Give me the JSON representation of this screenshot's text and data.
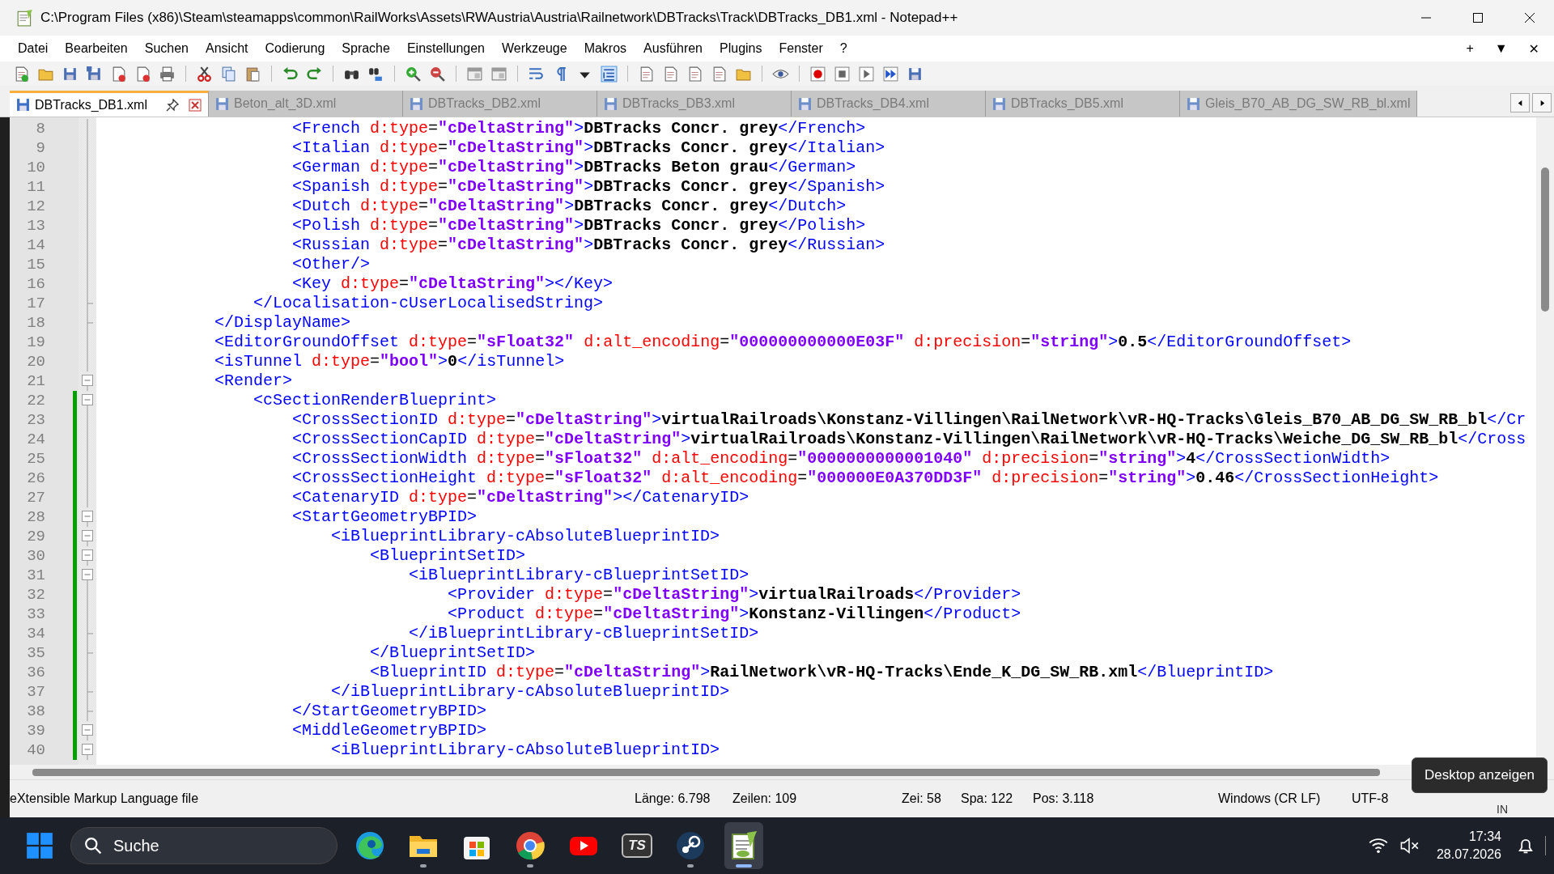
{
  "window": {
    "title": "C:\\Program Files (x86)\\Steam\\steamapps\\common\\RailWorks\\Assets\\RWAustria\\Austria\\Railnetwork\\DBTracks\\Track\\DBTracks_DB1.xml - Notepad++"
  },
  "menu": [
    "Datei",
    "Bearbeiten",
    "Suchen",
    "Ansicht",
    "Codierung",
    "Sprache",
    "Einstellungen",
    "Werkzeuge",
    "Makros",
    "Ausführen",
    "Plugins",
    "Fenster",
    "?"
  ],
  "menu_right": [
    "+",
    "▼",
    "✕"
  ],
  "tabs": [
    {
      "label": "DBTracks_DB1.xml",
      "selected": true
    },
    {
      "label": "Beton_alt_3D.xml",
      "selected": false
    },
    {
      "label": "DBTracks_DB2.xml",
      "selected": false
    },
    {
      "label": "DBTracks_DB3.xml",
      "selected": false
    },
    {
      "label": "DBTracks_DB4.xml",
      "selected": false
    },
    {
      "label": "DBTracks_DB5.xml",
      "selected": false
    },
    {
      "label": "Gleis_B70_AB_DG_SW_RB_bl.xml",
      "selected": false
    }
  ],
  "editor": {
    "lines": [
      {
        "number": "8",
        "kind": "fold-body",
        "changed": false,
        "tokens": [
          {
            "kind": "tag",
            "text": "                    <French"
          },
          {
            "kind": "attr",
            "text": " d:type"
          },
          {
            "kind": "eq",
            "text": "="
          },
          {
            "kind": "value",
            "text": "\"cDeltaString\""
          },
          {
            "kind": "tag",
            "text": ">"
          },
          {
            "kind": "text",
            "text": "DBTracks Concr. grey"
          },
          {
            "kind": "tag",
            "text": "</French>"
          }
        ]
      },
      {
        "number": "9",
        "kind": "fold-body",
        "changed": false,
        "tokens": [
          {
            "kind": "tag",
            "text": "                    <Italian"
          },
          {
            "kind": "attr",
            "text": " d:type"
          },
          {
            "kind": "eq",
            "text": "="
          },
          {
            "kind": "value",
            "text": "\"cDeltaString\""
          },
          {
            "kind": "tag",
            "text": ">"
          },
          {
            "kind": "text",
            "text": "DBTracks Concr. grey"
          },
          {
            "kind": "tag",
            "text": "</Italian>"
          }
        ]
      },
      {
        "number": "10",
        "kind": "fold-body",
        "changed": false,
        "tokens": [
          {
            "kind": "tag",
            "text": "                    <German"
          },
          {
            "kind": "attr",
            "text": " d:type"
          },
          {
            "kind": "eq",
            "text": "="
          },
          {
            "kind": "value",
            "text": "\"cDeltaString\""
          },
          {
            "kind": "tag",
            "text": ">"
          },
          {
            "kind": "text",
            "text": "DBTracks Beton grau"
          },
          {
            "kind": "tag",
            "text": "</German>"
          }
        ]
      },
      {
        "number": "11",
        "kind": "fold-body",
        "changed": false,
        "tokens": [
          {
            "kind": "tag",
            "text": "                    <Spanish"
          },
          {
            "kind": "attr",
            "text": " d:type"
          },
          {
            "kind": "eq",
            "text": "="
          },
          {
            "kind": "value",
            "text": "\"cDeltaString\""
          },
          {
            "kind": "tag",
            "text": ">"
          },
          {
            "kind": "text",
            "text": "DBTracks Concr. grey"
          },
          {
            "kind": "tag",
            "text": "</Spanish>"
          }
        ]
      },
      {
        "number": "12",
        "kind": "fold-body",
        "changed": false,
        "tokens": [
          {
            "kind": "tag",
            "text": "                    <Dutch"
          },
          {
            "kind": "attr",
            "text": " d:type"
          },
          {
            "kind": "eq",
            "text": "="
          },
          {
            "kind": "value",
            "text": "\"cDeltaString\""
          },
          {
            "kind": "tag",
            "text": ">"
          },
          {
            "kind": "text",
            "text": "DBTracks Concr. grey"
          },
          {
            "kind": "tag",
            "text": "</Dutch>"
          }
        ]
      },
      {
        "number": "13",
        "kind": "fold-body",
        "changed": false,
        "tokens": [
          {
            "kind": "tag",
            "text": "                    <Polish"
          },
          {
            "kind": "attr",
            "text": " d:type"
          },
          {
            "kind": "eq",
            "text": "="
          },
          {
            "kind": "value",
            "text": "\"cDeltaString\""
          },
          {
            "kind": "tag",
            "text": ">"
          },
          {
            "kind": "text",
            "text": "DBTracks Concr. grey"
          },
          {
            "kind": "tag",
            "text": "</Polish>"
          }
        ]
      },
      {
        "number": "14",
        "kind": "fold-body",
        "changed": false,
        "tokens": [
          {
            "kind": "tag",
            "text": "                    <Russian"
          },
          {
            "kind": "attr",
            "text": " d:type"
          },
          {
            "kind": "eq",
            "text": "="
          },
          {
            "kind": "value",
            "text": "\"cDeltaString\""
          },
          {
            "kind": "tag",
            "text": ">"
          },
          {
            "kind": "text",
            "text": "DBTracks Concr. grey"
          },
          {
            "kind": "tag",
            "text": "</Russian>"
          }
        ]
      },
      {
        "number": "15",
        "kind": "fold-body",
        "changed": false,
        "tokens": [
          {
            "kind": "tag",
            "text": "                    <Other/>"
          }
        ]
      },
      {
        "number": "16",
        "kind": "fold-body",
        "changed": false,
        "tokens": [
          {
            "kind": "tag",
            "text": "                    <Key"
          },
          {
            "kind": "attr",
            "text": " d:type"
          },
          {
            "kind": "eq",
            "text": "="
          },
          {
            "kind": "value",
            "text": "\"cDeltaString\""
          },
          {
            "kind": "tag",
            "text": "></Key>"
          }
        ]
      },
      {
        "number": "17",
        "kind": "fold-end",
        "changed": false,
        "tokens": [
          {
            "kind": "tag",
            "text": "                </Localisation-cUserLocalisedString>"
          }
        ]
      },
      {
        "number": "18",
        "kind": "fold-end",
        "changed": false,
        "tokens": [
          {
            "kind": "tag",
            "text": "            </DisplayName>"
          }
        ]
      },
      {
        "number": "19",
        "kind": "fold-body",
        "changed": false,
        "tokens": [
          {
            "kind": "tag",
            "text": "            <EditorGroundOffset"
          },
          {
            "kind": "attr",
            "text": " d:type"
          },
          {
            "kind": "eq",
            "text": "="
          },
          {
            "kind": "value",
            "text": "\"sFloat32\""
          },
          {
            "kind": "attr",
            "text": " d:alt_encoding"
          },
          {
            "kind": "eq",
            "text": "="
          },
          {
            "kind": "value",
            "text": "\"000000000000E03F\""
          },
          {
            "kind": "attr",
            "text": " d:precision"
          },
          {
            "kind": "eq",
            "text": "="
          },
          {
            "kind": "value",
            "text": "\"string\""
          },
          {
            "kind": "tag",
            "text": ">"
          },
          {
            "kind": "text",
            "text": "0.5"
          },
          {
            "kind": "tag",
            "text": "</EditorGroundOffset>"
          }
        ]
      },
      {
        "number": "20",
        "kind": "fold-body",
        "changed": false,
        "tokens": [
          {
            "kind": "tag",
            "text": "            <isTunnel"
          },
          {
            "kind": "attr",
            "text": " d:type"
          },
          {
            "kind": "eq",
            "text": "="
          },
          {
            "kind": "value",
            "text": "\"bool\""
          },
          {
            "kind": "tag",
            "text": ">"
          },
          {
            "kind": "text",
            "text": "0"
          },
          {
            "kind": "tag",
            "text": "</isTunnel>"
          }
        ]
      },
      {
        "number": "21",
        "kind": "fold-start",
        "changed": false,
        "tokens": [
          {
            "kind": "tag",
            "text": "            <Render>"
          }
        ]
      },
      {
        "number": "22",
        "kind": "fold-start",
        "changed": true,
        "tokens": [
          {
            "kind": "tag",
            "text": "                <cSectionRenderBlueprint>"
          }
        ]
      },
      {
        "number": "23",
        "kind": "fold-body",
        "changed": true,
        "tokens": [
          {
            "kind": "tag",
            "text": "                    <CrossSectionID"
          },
          {
            "kind": "attr",
            "text": " d:type"
          },
          {
            "kind": "eq",
            "text": "="
          },
          {
            "kind": "value",
            "text": "\"cDeltaString\""
          },
          {
            "kind": "tag",
            "text": ">"
          },
          {
            "kind": "text",
            "text": "virtualRailroads\\Konstanz-Villingen\\RailNetwork\\vR-HQ-Tracks\\Gleis_B70_AB_DG_SW_RB_bl"
          },
          {
            "kind": "tag",
            "text": "</Cr"
          }
        ]
      },
      {
        "number": "24",
        "kind": "fold-body",
        "changed": true,
        "tokens": [
          {
            "kind": "tag",
            "text": "                    <CrossSectionCapID"
          },
          {
            "kind": "attr",
            "text": " d:type"
          },
          {
            "kind": "eq",
            "text": "="
          },
          {
            "kind": "value",
            "text": "\"cDeltaString\""
          },
          {
            "kind": "tag",
            "text": ">"
          },
          {
            "kind": "text",
            "text": "virtualRailroads\\Konstanz-Villingen\\RailNetwork\\vR-HQ-Tracks\\Weiche_DG_SW_RB_bl"
          },
          {
            "kind": "tag",
            "text": "</Cross"
          }
        ]
      },
      {
        "number": "25",
        "kind": "fold-body",
        "changed": true,
        "tokens": [
          {
            "kind": "tag",
            "text": "                    <CrossSectionWidth"
          },
          {
            "kind": "attr",
            "text": " d:type"
          },
          {
            "kind": "eq",
            "text": "="
          },
          {
            "kind": "value",
            "text": "\"sFloat32\""
          },
          {
            "kind": "attr",
            "text": " d:alt_encoding"
          },
          {
            "kind": "eq",
            "text": "="
          },
          {
            "kind": "value",
            "text": "\"0000000000001040\""
          },
          {
            "kind": "attr",
            "text": " d:precision"
          },
          {
            "kind": "eq",
            "text": "="
          },
          {
            "kind": "value",
            "text": "\"string\""
          },
          {
            "kind": "tag",
            "text": ">"
          },
          {
            "kind": "text",
            "text": "4"
          },
          {
            "kind": "tag",
            "text": "</CrossSectionWidth>"
          }
        ]
      },
      {
        "number": "26",
        "kind": "fold-body",
        "changed": true,
        "tokens": [
          {
            "kind": "tag",
            "text": "                    <CrossSectionHeight"
          },
          {
            "kind": "attr",
            "text": " d:type"
          },
          {
            "kind": "eq",
            "text": "="
          },
          {
            "kind": "value",
            "text": "\"sFloat32\""
          },
          {
            "kind": "attr",
            "text": " d:alt_encoding"
          },
          {
            "kind": "eq",
            "text": "="
          },
          {
            "kind": "value",
            "text": "\"000000E0A370DD3F\""
          },
          {
            "kind": "attr",
            "text": " d:precision"
          },
          {
            "kind": "eq",
            "text": "="
          },
          {
            "kind": "value",
            "text": "\"string\""
          },
          {
            "kind": "tag",
            "text": ">"
          },
          {
            "kind": "text",
            "text": "0.46"
          },
          {
            "kind": "tag",
            "text": "</CrossSectionHeight>"
          }
        ]
      },
      {
        "number": "27",
        "kind": "fold-body",
        "changed": true,
        "tokens": [
          {
            "kind": "tag",
            "text": "                    <CatenaryID"
          },
          {
            "kind": "attr",
            "text": " d:type"
          },
          {
            "kind": "eq",
            "text": "="
          },
          {
            "kind": "value",
            "text": "\"cDeltaString\""
          },
          {
            "kind": "tag",
            "text": "></CatenaryID>"
          }
        ]
      },
      {
        "number": "28",
        "kind": "fold-start",
        "changed": true,
        "tokens": [
          {
            "kind": "tag",
            "text": "                    <StartGeometryBPID>"
          }
        ]
      },
      {
        "number": "29",
        "kind": "fold-start",
        "changed": true,
        "tokens": [
          {
            "kind": "tag",
            "text": "                        <iBlueprintLibrary-cAbsoluteBlueprintID>"
          }
        ]
      },
      {
        "number": "30",
        "kind": "fold-start",
        "changed": true,
        "tokens": [
          {
            "kind": "tag",
            "text": "                            <BlueprintSetID>"
          }
        ]
      },
      {
        "number": "31",
        "kind": "fold-start",
        "changed": true,
        "tokens": [
          {
            "kind": "tag",
            "text": "                                <iBlueprintLibrary-cBlueprintSetID>"
          }
        ]
      },
      {
        "number": "32",
        "kind": "fold-body",
        "changed": true,
        "tokens": [
          {
            "kind": "tag",
            "text": "                                    <Provider"
          },
          {
            "kind": "attr",
            "text": " d:type"
          },
          {
            "kind": "eq",
            "text": "="
          },
          {
            "kind": "value",
            "text": "\"cDeltaString\""
          },
          {
            "kind": "tag",
            "text": ">"
          },
          {
            "kind": "text",
            "text": "virtualRailroads"
          },
          {
            "kind": "tag",
            "text": "</Provider>"
          }
        ]
      },
      {
        "number": "33",
        "kind": "fold-body",
        "changed": true,
        "tokens": [
          {
            "kind": "tag",
            "text": "                                    <Product"
          },
          {
            "kind": "attr",
            "text": " d:type"
          },
          {
            "kind": "eq",
            "text": "="
          },
          {
            "kind": "value",
            "text": "\"cDeltaString\""
          },
          {
            "kind": "tag",
            "text": ">"
          },
          {
            "kind": "text",
            "text": "Konstanz-Villingen"
          },
          {
            "kind": "tag",
            "text": "</Product>"
          }
        ]
      },
      {
        "number": "34",
        "kind": "fold-end",
        "changed": true,
        "tokens": [
          {
            "kind": "tag",
            "text": "                                </iBlueprintLibrary-cBlueprintSetID>"
          }
        ]
      },
      {
        "number": "35",
        "kind": "fold-end",
        "changed": true,
        "tokens": [
          {
            "kind": "tag",
            "text": "                            </BlueprintSetID>"
          }
        ]
      },
      {
        "number": "36",
        "kind": "fold-body",
        "changed": true,
        "tokens": [
          {
            "kind": "tag",
            "text": "                            <BlueprintID"
          },
          {
            "kind": "attr",
            "text": " d:type"
          },
          {
            "kind": "eq",
            "text": "="
          },
          {
            "kind": "value",
            "text": "\"cDeltaString\""
          },
          {
            "kind": "tag",
            "text": ">"
          },
          {
            "kind": "text",
            "text": "RailNetwork\\vR-HQ-Tracks\\Ende_K_DG_SW_RB.xml"
          },
          {
            "kind": "tag",
            "text": "</BlueprintID>"
          }
        ]
      },
      {
        "number": "37",
        "kind": "fold-end",
        "changed": true,
        "tokens": [
          {
            "kind": "tag",
            "text": "                        </iBlueprintLibrary-cAbsoluteBlueprintID>"
          }
        ]
      },
      {
        "number": "38",
        "kind": "fold-end",
        "changed": true,
        "tokens": [
          {
            "kind": "tag",
            "text": "                    </StartGeometryBPID>"
          }
        ]
      },
      {
        "number": "39",
        "kind": "fold-start",
        "changed": true,
        "tokens": [
          {
            "kind": "tag",
            "text": "                    <MiddleGeometryBPID>"
          }
        ]
      },
      {
        "number": "40",
        "kind": "fold-start",
        "changed": true,
        "tokens": [
          {
            "kind": "tag",
            "text": "                        <iBlueprintLibrary-cAbsoluteBlueprintID>"
          }
        ]
      }
    ]
  },
  "status_bar": [
    {
      "kind": "type",
      "text": "eXtensible Markup Language file"
    },
    {
      "kind": "length",
      "text": "Länge: 6.798"
    },
    {
      "kind": "lines",
      "text": "Zeilen: 109"
    },
    {
      "kind": "row",
      "text": "Zei: 58"
    },
    {
      "kind": "col",
      "text": "Spa: 122"
    },
    {
      "kind": "pos",
      "text": "Pos: 3.118"
    },
    {
      "kind": "eol",
      "text": "Windows (CR LF)"
    },
    {
      "kind": "enc",
      "text": "UTF-8"
    },
    {
      "kind": "mode",
      "text": "IN"
    }
  ],
  "tooltip": "Desktop anzeigen",
  "taskbar": {
    "search_placeholder": "Suche",
    "apps": [
      {
        "kind": "edge",
        "running": false,
        "selected": false
      },
      {
        "kind": "folder",
        "running": true,
        "selected": false
      },
      {
        "kind": "store",
        "running": false,
        "selected": false
      },
      {
        "kind": "chrome",
        "running": true,
        "selected": false
      },
      {
        "kind": "video",
        "running": false,
        "selected": false
      },
      {
        "kind": "ts",
        "label": "TS",
        "running": false,
        "selected": false
      },
      {
        "kind": "steam",
        "running": true,
        "selected": false
      },
      {
        "kind": "notepad",
        "running": true,
        "selected": true
      }
    ],
    "time": "17:34",
    "date": "28.07.2026"
  }
}
